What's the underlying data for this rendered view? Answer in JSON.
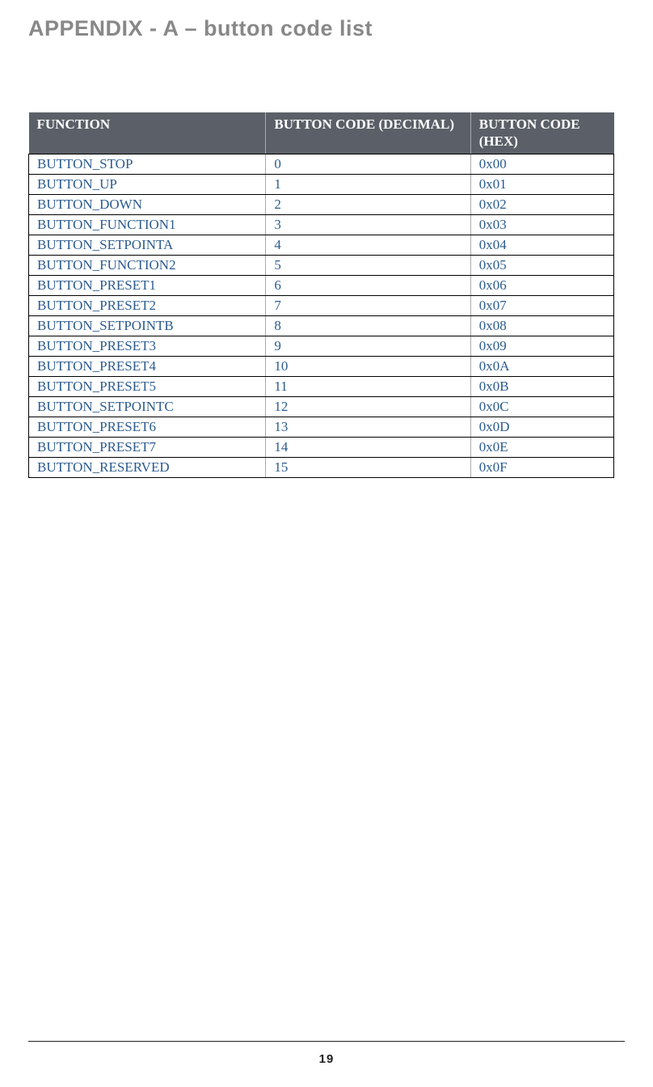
{
  "title": "APPENDIX  - A – button code list",
  "table": {
    "headers": {
      "function": "FUNCTION",
      "decimal": "BUTTON CODE (DECIMAL)",
      "hex": "BUTTON CODE (HEX)"
    },
    "rows": [
      {
        "function": "BUTTON_STOP",
        "decimal": "0",
        "hex": "0x00"
      },
      {
        "function": "BUTTON_UP",
        "decimal": "1",
        "hex": "0x01"
      },
      {
        "function": "BUTTON_DOWN",
        "decimal": "2",
        "hex": "0x02"
      },
      {
        "function": "BUTTON_FUNCTION1",
        "decimal": "3",
        "hex": "0x03"
      },
      {
        "function": "BUTTON_SETPOINTA",
        "decimal": "4",
        "hex": "0x04"
      },
      {
        "function": "BUTTON_FUNCTION2",
        "decimal": "5",
        "hex": "0x05"
      },
      {
        "function": "BUTTON_PRESET1",
        "decimal": "6",
        "hex": "0x06"
      },
      {
        "function": "BUTTON_PRESET2",
        "decimal": "7",
        "hex": "0x07"
      },
      {
        "function": "BUTTON_SETPOINTB",
        "decimal": "8",
        "hex": "0x08"
      },
      {
        "function": "BUTTON_PRESET3",
        "decimal": "9",
        "hex": "0x09"
      },
      {
        "function": "BUTTON_PRESET4",
        "decimal": "10",
        "hex": "0x0A"
      },
      {
        "function": "BUTTON_PRESET5",
        "decimal": "11",
        "hex": "0x0B"
      },
      {
        "function": "BUTTON_SETPOINTC",
        "decimal": "12",
        "hex": "0x0C"
      },
      {
        "function": "BUTTON_PRESET6",
        "decimal": "13",
        "hex": "0x0D"
      },
      {
        "function": "BUTTON_PRESET7",
        "decimal": "14",
        "hex": "0x0E"
      },
      {
        "function": "BUTTON_RESERVED",
        "decimal": "15",
        "hex": "0x0F"
      }
    ]
  },
  "page_number": "19"
}
